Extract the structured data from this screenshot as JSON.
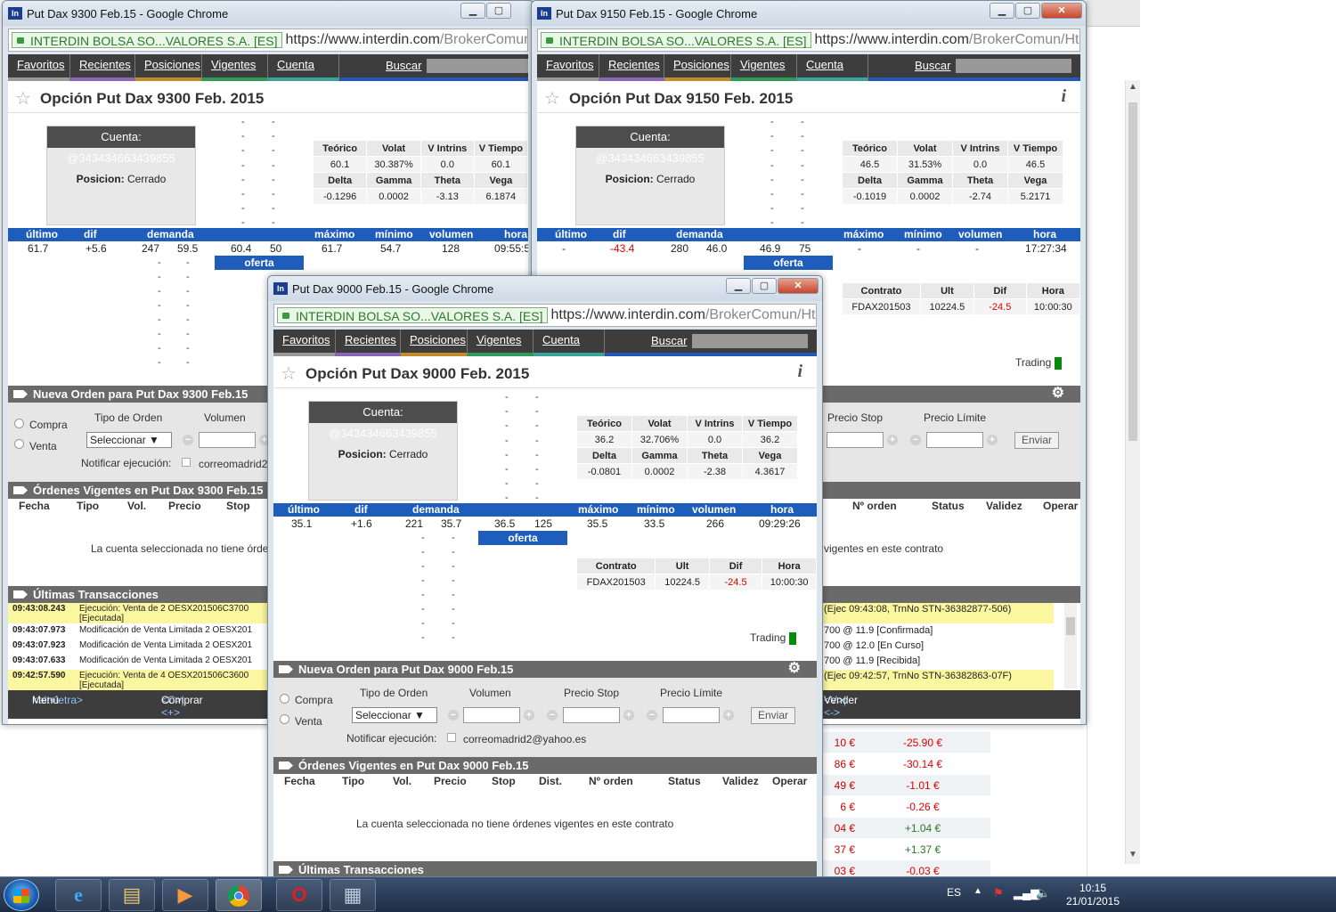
{
  "nav": {
    "items": [
      "Favoritos",
      "Recientes",
      "Posiciones",
      "Vigentes",
      "Cuenta"
    ],
    "search": "Buscar"
  },
  "address": {
    "cert": "INTERDIN BOLSA SO...VALORES S.A. [ES]",
    "url_main": "https://www.interdin.com",
    "url_path": "/BrokerComun/Ht"
  },
  "common": {
    "account": "Cuenta: @343434663439855",
    "position_label": "Posicion:",
    "position_value": "Cerrado",
    "greek_head1": [
      "Teórico",
      "Volat",
      "V Intrins",
      "V Tiempo"
    ],
    "greek_head2": [
      "Delta",
      "Gamma",
      "Theta",
      "Vega"
    ],
    "quote_left": [
      "último",
      "dif",
      "demanda"
    ],
    "quote_right": [
      "máximo",
      "mínimo",
      "volumen",
      "hora"
    ],
    "oferta": "oferta",
    "dash": "-",
    "contract_head": [
      "Contrato",
      "Ult",
      "Dif",
      "Hora"
    ],
    "trading": "Trading",
    "compra": "Compra",
    "venta": "Venta",
    "tipo": "Tipo de Orden",
    "volumen": "Volumen",
    "stop": "Precio Stop",
    "limite": "Precio Límite",
    "select": "Seleccionar ▼",
    "enviar": "Enviar",
    "notify": "Notificar ejecución:",
    "email": "correomadrid2@yahoo.es",
    "orders_cols": [
      "Fecha",
      "Tipo",
      "Vol.",
      "Precio",
      "Stop",
      "Dist.",
      "Nº orden",
      "Status",
      "Validez",
      "Operar"
    ],
    "no_orders": "La cuenta seleccionada no tiene órdenes vigentes en este contrato",
    "last_tx": "Últimas Transacciones",
    "foot_menu_k": "<alt+letra>",
    "foot_menu": "Menú",
    "foot_buy_k": "<C>|<+>",
    "foot_buy": "Comprar",
    "foot_sell_k": "<V>|<->",
    "foot_sell": "Vender"
  },
  "w1": {
    "title": "Put Dax 9300 Feb.15 - Google Chrome",
    "heading": "Opción Put Dax 9300 Feb. 2015",
    "greek_vals1": [
      "60.1",
      "30.387%",
      "0.0",
      "60.1"
    ],
    "greek_vals2": [
      "-0.1296",
      "0.0002",
      "-3.13",
      "6.1874"
    ],
    "quote": {
      "ultimo": "61.7",
      "dif": "+5.6",
      "dem_q": "247",
      "dem_p": "59.5",
      "of_p": "60.4",
      "of_q": "50",
      "max": "61.7",
      "min": "54.7",
      "vol": "128",
      "hora": "09:55:5"
    },
    "new_order": "Nueva Orden para Put Dax 9300 Feb.15",
    "orders": "Órdenes Vigentes en Put Dax 9300 Feb.15",
    "no_orders_clip": "La cuenta seleccionada no tiene órde",
    "tx": [
      {
        "t": "09:43:08.243",
        "d": "Ejecución: Venta de 2 OESX201506C3700",
        "d2": "[Ejecutada]",
        "hl": true
      },
      {
        "t": "09:43:07.973",
        "d": "Modificación de Venta Limitada 2 OESX201",
        "d2": "",
        "hl": false
      },
      {
        "t": "09:43:07.923",
        "d": "Modificación de Venta Limitada 2 OESX201",
        "d2": "",
        "hl": false
      },
      {
        "t": "09:43:07.633",
        "d": "Modificación de Venta Limitada 2 OESX201",
        "d2": "",
        "hl": false
      },
      {
        "t": "09:42:57.590",
        "d": "Ejecución: Venta de 4 OESX201506C3600",
        "d2": "[Ejecutada]",
        "hl": true
      }
    ]
  },
  "w2": {
    "title": "Put Dax 9150 Feb.15 - Google Chrome",
    "heading": "Opción Put Dax 9150 Feb. 2015",
    "greek_vals1": [
      "46.5",
      "31.53%",
      "0.0",
      "46.5"
    ],
    "greek_vals2": [
      "-0.1019",
      "0.0002",
      "-2.74",
      "5.2171"
    ],
    "quote": {
      "ultimo": "-",
      "dif": "-43.4",
      "dem_q": "280",
      "dem_p": "46.0",
      "of_p": "46.9",
      "of_q": "75",
      "max": "-",
      "min": "-",
      "vol": "-",
      "hora": "17:27:34"
    },
    "contract_vals": [
      "FDAX201503",
      "10224.5",
      "-24.5",
      "10:00:30"
    ],
    "orders_tail": "vigentes en este contrato",
    "tx_tail": [
      "(Ejec 09:43:08, TrnNo STN-36382877-506)",
      "700 @ 11.9 [Confirmada]",
      "700 @ 12.0 [En Curso]",
      "700 @ 11.9 [Recibida]",
      "(Ejec 09:42:57, TrnNo STN-36382863-07F)"
    ]
  },
  "w3": {
    "title": "Put Dax 9000 Feb.15 - Google Chrome",
    "heading": "Opción Put Dax 9000 Feb. 2015",
    "greek_vals1": [
      "36.2",
      "32.706%",
      "0.0",
      "36.2"
    ],
    "greek_vals2": [
      "-0.0801",
      "0.0002",
      "-2.38",
      "4.3617"
    ],
    "quote": {
      "ultimo": "35.1",
      "dif": "+1.6",
      "dem_q": "221",
      "dem_p": "35.7",
      "of_p": "36.5",
      "of_q": "125",
      "max": "35.5",
      "min": "33.5",
      "vol": "266",
      "hora": "09:29:26"
    },
    "contract_vals": [
      "FDAX201503",
      "10224.5",
      "-24.5",
      "10:00:30"
    ],
    "new_order": "Nueva Orden para Put Dax 9000 Feb.15",
    "orders": "Órdenes Vigentes en Put Dax 9000 Feb.15"
  },
  "bg_rows": [
    [
      "10 €",
      "-25.90 €"
    ],
    [
      "86 €",
      "-30.14 €"
    ],
    [
      "49 €",
      "-1.01 €"
    ],
    [
      "6 €",
      "-0.26 €"
    ],
    [
      "04 €",
      "+1.04 €"
    ],
    [
      "37 €",
      "+1.37 €"
    ],
    [
      "03 €",
      "-0.03 €"
    ]
  ],
  "taskbar": {
    "lang": "ES",
    "time": "10:15",
    "date": "21/01/2015"
  },
  "colors": {
    "blue_band": "#1f5dbd",
    "nav_bg": "#3d3d3d",
    "neg": "#dd0000",
    "pos": "#2a7a2a"
  }
}
